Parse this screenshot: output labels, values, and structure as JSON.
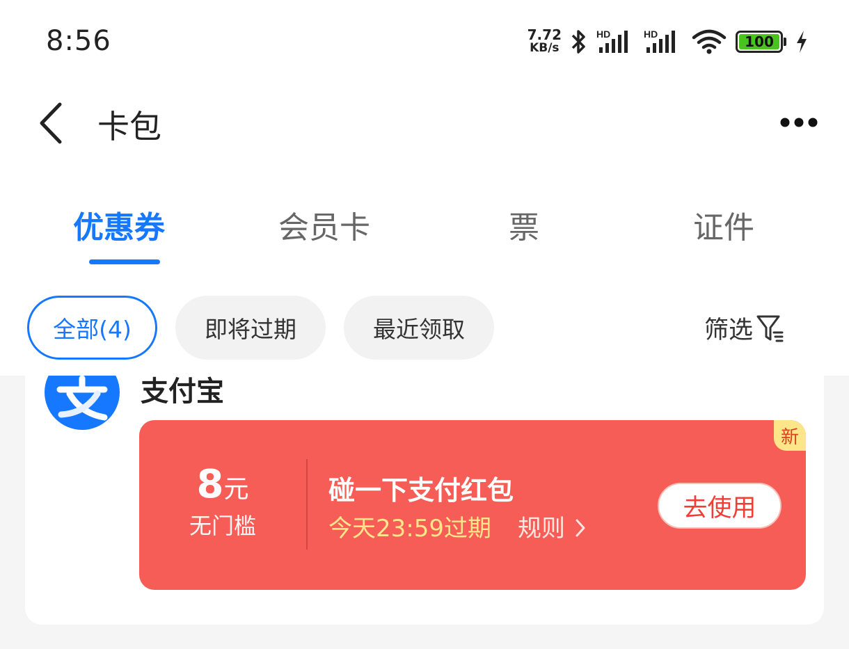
{
  "status_bar": {
    "time": "8:56",
    "net_speed_value": "7.72",
    "net_speed_unit": "KB/s",
    "battery": "100",
    "icons": [
      "bluetooth-icon",
      "hd-signal-icon",
      "hd-signal-icon",
      "wifi-icon",
      "battery-icon",
      "charging-icon"
    ]
  },
  "nav": {
    "title": "卡包",
    "back_icon": "chevron-left-icon",
    "more_icon": "more-dots-icon"
  },
  "tabs": [
    {
      "label": "优惠券",
      "active": true
    },
    {
      "label": "会员卡",
      "active": false
    },
    {
      "label": "票",
      "active": false
    },
    {
      "label": "证件",
      "active": false
    }
  ],
  "filters": {
    "chips": [
      {
        "label": "全部(4)",
        "active": true
      },
      {
        "label": "即将过期",
        "active": false
      },
      {
        "label": "最近领取",
        "active": false
      }
    ],
    "filter_label": "筛选",
    "filter_icon": "funnel-icon"
  },
  "merchant": {
    "name": "支付宝",
    "logo_glyph": "支"
  },
  "coupon": {
    "badge": "新",
    "amount": "8",
    "unit": "元",
    "condition": "无门槛",
    "title": "碰一下支付红包",
    "expire": "今天23:59过期",
    "rules": "规则",
    "button": "去使用"
  },
  "colors": {
    "accent": "#1677ff",
    "coupon_bg": "#f55d56",
    "expire_text": "#ffe68a",
    "battery_fill": "#49c41f"
  }
}
